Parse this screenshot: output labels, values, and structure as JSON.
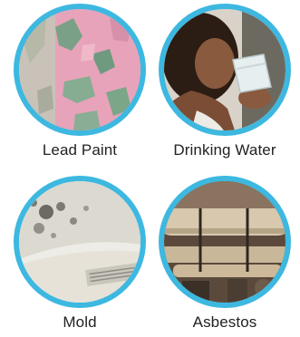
{
  "tiles": [
    {
      "label": "Lead Paint",
      "icon": "peeling-paint-photo"
    },
    {
      "label": "Drinking Water",
      "icon": "person-drinking-water-photo"
    },
    {
      "label": "Mold",
      "icon": "mold-ceiling-photo"
    },
    {
      "label": "Asbestos",
      "icon": "asbestos-pipes-photo"
    }
  ],
  "colors": {
    "ring": "#3db8e0",
    "text": "#222222"
  }
}
